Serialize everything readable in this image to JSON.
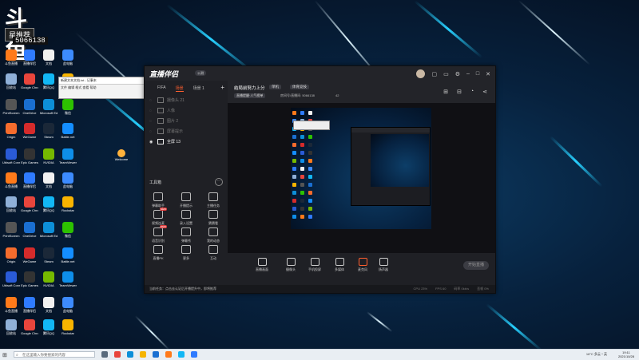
{
  "desktop": {
    "logo_text": "斗鱼",
    "logo_sub": "星推荐",
    "room_number": "5066138",
    "icons": [
      {
        "label": "斗鱼直播",
        "color": "#ff7a1a"
      },
      {
        "label": "直播伴侣",
        "color": "#2f7bff"
      },
      {
        "label": "文档",
        "color": "#f1f1f1"
      },
      {
        "label": "此电脑",
        "color": "#3d8bfd"
      },
      {
        "label": "回收站",
        "color": "#8fb0d8"
      },
      {
        "label": "Google Chrome",
        "color": "#e8453c"
      },
      {
        "label": "腾讯QQ",
        "color": "#12b7f5"
      },
      {
        "label": "Rockstar",
        "color": "#f8b400"
      },
      {
        "label": "PrintScreen",
        "color": "#555"
      },
      {
        "label": "OneDrive",
        "color": "#1a6fd1"
      },
      {
        "label": "Microsoft Edge",
        "color": "#0d8fd8"
      },
      {
        "label": "微信",
        "color": "#2dc100"
      },
      {
        "label": "Origin",
        "color": "#f56c2d"
      },
      {
        "label": "WeGame",
        "color": "#d52b2b"
      },
      {
        "label": "Steam",
        "color": "#1b2838"
      },
      {
        "label": "Battle.net",
        "color": "#148eff"
      },
      {
        "label": "Ubisoft Connect",
        "color": "#2a5bd7"
      },
      {
        "label": "Epic Games",
        "color": "#333"
      },
      {
        "label": "NVIDIA",
        "color": "#76b900"
      },
      {
        "label": "TeamViewer",
        "color": "#0e8ee9"
      }
    ],
    "notes_title": "新建文本文档.txt - 记事本",
    "notes_menu": "文件 编辑 格式 查看 帮助",
    "welcome_label": "Welcome"
  },
  "app": {
    "brand": "直播伴侣",
    "brand_badge": "公测",
    "titlebar_icons": [
      "shirt-icon",
      "notification-icon",
      "settings-icon",
      "minimize-icon",
      "maximize-icon",
      "close-icon"
    ],
    "tabs": [
      "FIFA",
      "场景",
      "场景 1"
    ],
    "add_scene": "+",
    "scenes": [
      {
        "label": "摄像头 21",
        "visible": false
      },
      {
        "label": "人像",
        "visible": false
      },
      {
        "label": "图片 2",
        "visible": false
      },
      {
        "label": "屏幕提示",
        "visible": false
      },
      {
        "label": "全屏 13",
        "visible": true
      }
    ],
    "tools_title": "工具箱",
    "tools_more": "···",
    "tools": [
      {
        "label": "弹幕助手"
      },
      {
        "label": "开播提示"
      },
      {
        "label": "主播任务"
      },
      {
        "label": "视频连麦",
        "new": "NEW"
      },
      {
        "label": "录入设置"
      },
      {
        "label": "猜猜看"
      },
      {
        "label": "语音识别",
        "new": "NEW"
      },
      {
        "label": "弹幕秀"
      },
      {
        "label": "我的动态"
      },
      {
        "label": "直播PK"
      },
      {
        "label": "更多"
      },
      {
        "label": "互动"
      }
    ],
    "room": {
      "title": "结局前努力上分",
      "category": "单机",
      "sub_category": "体育竞技",
      "tag": "直播提醒·人气榜单",
      "room_id": "房间号/直播间: 5066138",
      "fans": "42"
    },
    "controls": [
      {
        "label": "直播画面"
      },
      {
        "label": "摄像头"
      },
      {
        "label": "手机投屏"
      },
      {
        "label": "多媒体"
      },
      {
        "label": "麦克风"
      },
      {
        "label": "扬声器"
      }
    ],
    "go_live": "开始直播",
    "status_msg": "当前任务：点击去认证后开播提升中，即将推荐",
    "stats": [
      "CPU 23%",
      "FPS 60",
      "码率 0kb/s",
      "丢帧 0%"
    ]
  },
  "taskbar": {
    "search_placeholder": "在这里输入你要搜索的内容",
    "tray": "16°C 多云  ^  英",
    "time": "19:11",
    "date": "2021/10/28"
  }
}
